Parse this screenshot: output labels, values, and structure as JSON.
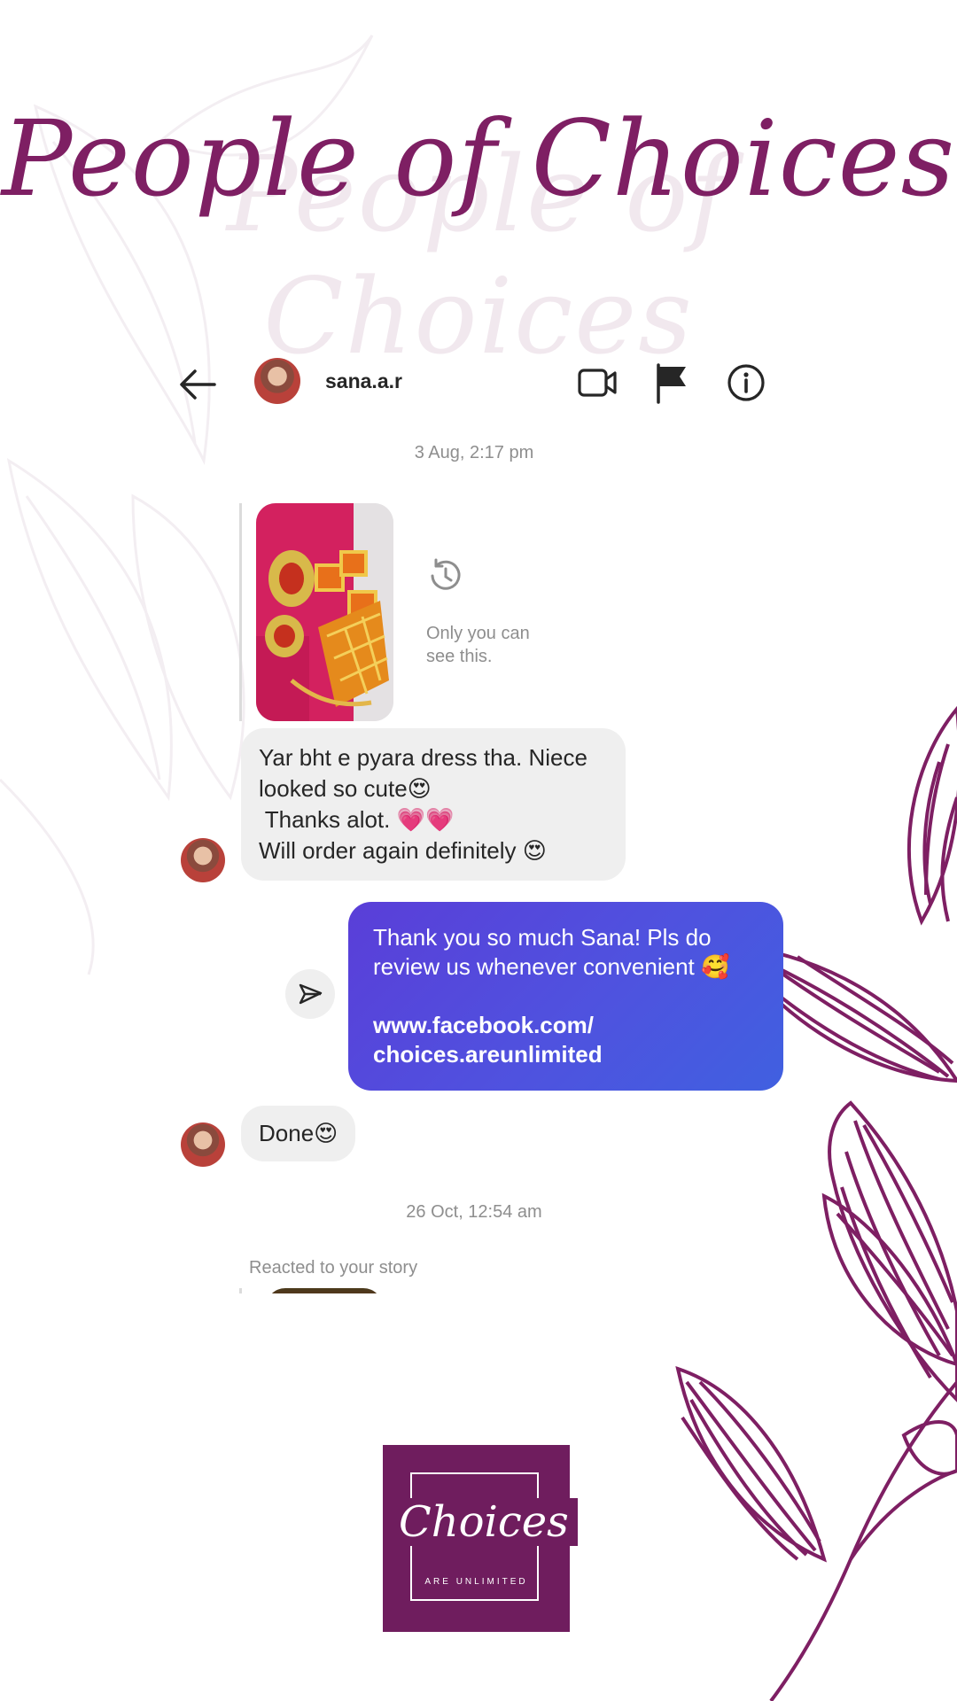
{
  "brand_title": "People of Choices",
  "chat": {
    "username": "sana.a.r",
    "date_1": "3 Aug, 2:17 pm",
    "story_note": "Only you can see this.",
    "msg_in_1": {
      "line1": "Yar bht e pyara dress tha. Niece",
      "line2": "looked so cute😍",
      "line3": " Thanks alot. 💗💗",
      "line4": "Will order again definitely 😍"
    },
    "msg_out_1": {
      "line1": "Thank you so much Sana! Pls do",
      "line2": "review us whenever convenient 🥰",
      "link1": "www.facebook.com/",
      "link2": "choices.areunlimited"
    },
    "msg_in_2": "Done😍",
    "date_2": "26 Oct, 12:54 am",
    "reacted_label": "Reacted to your story"
  },
  "icons": {
    "back": "arrow-left-icon",
    "video": "video-call-icon",
    "report": "flag-icon",
    "info": "info-icon",
    "history": "history-icon",
    "share": "send-icon"
  },
  "logo": {
    "word": "Choices",
    "tagline": "ARE UNLIMITED"
  },
  "colors": {
    "brand_purple": "#7e1f63",
    "logo_bg": "#6f1d5e",
    "outgoing_bubble": "#5048dc",
    "incoming_bubble": "#efefef",
    "meta_text": "#8e8e8e"
  }
}
